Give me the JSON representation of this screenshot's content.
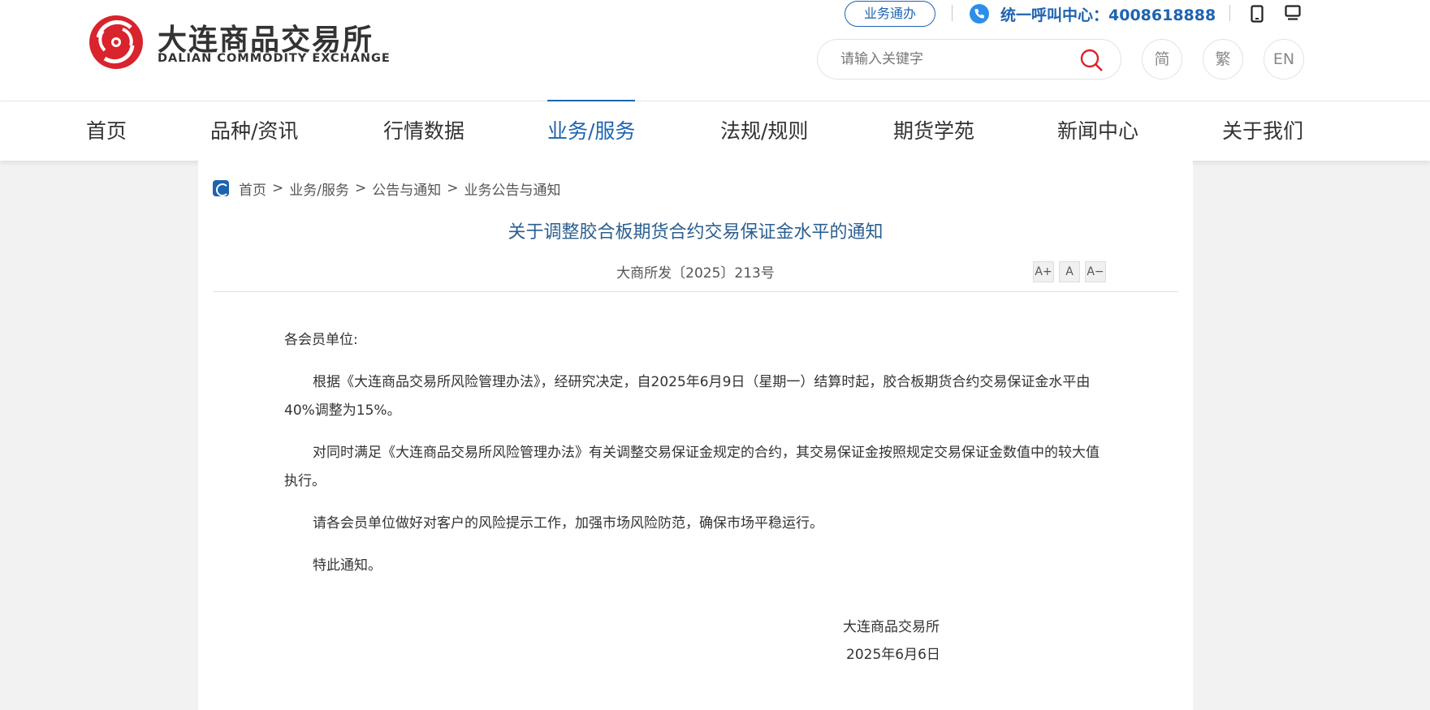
{
  "header": {
    "logo_cn": "大连商品交易所",
    "logo_en": "DALIAN COMMODITY EXCHANGE",
    "biz_button": "业务通办",
    "hotline": "统一呼叫中心：4008618888",
    "search": {
      "placeholder": "请输入关键字"
    },
    "languages": [
      "简",
      "繁",
      "EN"
    ]
  },
  "nav": {
    "items": [
      "首页",
      "品种/资讯",
      "行情数据",
      "业务/服务",
      "法规/规则",
      "期货学苑",
      "新闻中心",
      "关于我们"
    ],
    "active_index": 3
  },
  "breadcrumb": [
    "首页",
    "业务/服务",
    "公告与通知",
    "业务公告与通知"
  ],
  "article": {
    "title": "关于调整胶合板期货合约交易保证金水平的通知",
    "doc_number": "大商所发〔2025〕213号",
    "font_controls": [
      "A+",
      "A",
      "A−"
    ],
    "salutation": "各会员单位:",
    "paragraphs": [
      "根据《大连商品交易所风险管理办法》，经研究决定，自2025年6月9日（星期一）结算时起，胶合板期货合约交易保证金水平由40%调整为15%。",
      "对同时满足《大连商品交易所风险管理办法》有关调整交易保证金规定的合约，其交易保证金按照规定交易保证金数值中的较大值执行。",
      "请各会员单位做好对客户的风险提示工作，加强市场风险防范，确保市场平稳运行。",
      "特此通知。"
    ],
    "signature_org": "大连商品交易所",
    "signature_date": "2025年6月6日"
  },
  "colors": {
    "brand_blue": "#1e63b0",
    "logo_red": "#d9232d",
    "title_blue": "#2b5f8f"
  }
}
